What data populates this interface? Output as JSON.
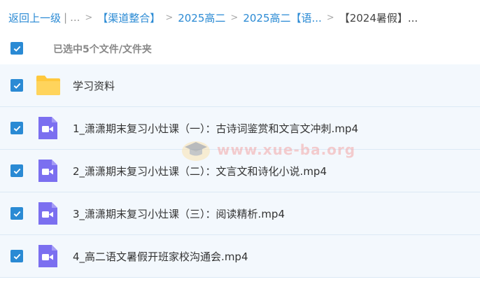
{
  "breadcrumb": {
    "back": "返回上一级",
    "divider": "|",
    "ellipsis": "...",
    "items": [
      "【渠道整合】",
      "2025高二",
      "2025高二【语..."
    ],
    "current": "【2024暑假】..."
  },
  "selection": {
    "text": "已选中5个文件/文件夹"
  },
  "files": [
    {
      "name": "学习资料",
      "type": "folder-icon"
    },
    {
      "name": "1_潇潇期末复习小灶课（一）：古诗词鉴赏和文言文冲刺.mp4",
      "type": "video-file-icon"
    },
    {
      "name": "2_潇潇期末复习小灶课（二）：文言文和诗化小说.mp4",
      "type": "video-file-icon"
    },
    {
      "name": "3_潇潇期末复习小灶课（三）：阅读精析.mp4",
      "type": "video-file-icon"
    },
    {
      "name": "4_高二语文暑假开班家校沟通会.mp4",
      "type": "video-file-icon"
    }
  ],
  "watermark": {
    "text": "www.xue-ba.org"
  },
  "colors": {
    "accent": "#2a8ad4",
    "folder": "#ffc83d",
    "video_icon": "#7b6ff0"
  }
}
